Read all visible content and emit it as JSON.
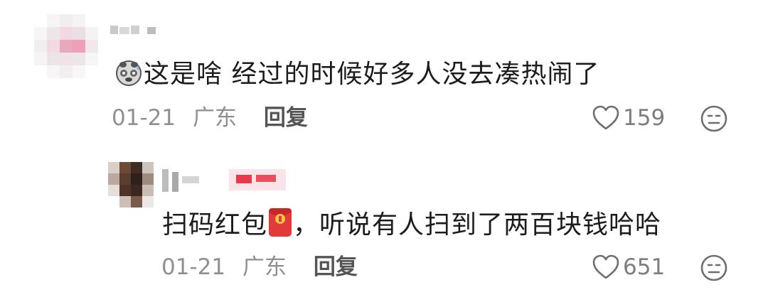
{
  "comments": [
    {
      "content": "这是啥 经过的时候好多人没去凑热闹了",
      "date": "01-21",
      "region": "广东",
      "reply_label": "回复",
      "like_count": "159",
      "emoji_icon": "panda-sweat-emoji-icon",
      "like_icon": "heart-outline-icon",
      "more_icon": "face-emoji-icon"
    },
    {
      "content_before": "扫码红包",
      "content_after": "，听说有人扫到了两百块钱哈哈",
      "date": "01-21",
      "region": "广东",
      "reply_label": "回复",
      "like_count": "651",
      "emoji_icon": "red-envelope-emoji-icon",
      "like_icon": "heart-outline-icon",
      "more_icon": "face-emoji-icon"
    }
  ],
  "colors": {
    "text": "#1c1c1c",
    "meta": "#8f8f8f",
    "reply": "#555555",
    "like_icon": "#6e6e6e",
    "badge_red": "#e83a4b"
  }
}
